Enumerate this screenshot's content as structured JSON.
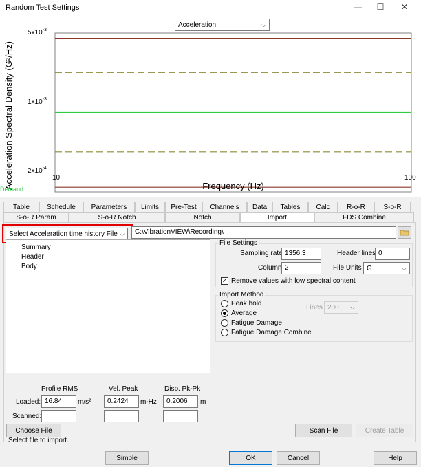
{
  "window": {
    "title": "Random Test Settings",
    "minimize": "—",
    "maximize": "☐",
    "close": "✕"
  },
  "chart_header": {
    "selected": "Acceleration"
  },
  "chart_data": {
    "type": "line",
    "ylabel": "Acceleration Spectral Density (G²/Hz)",
    "xlabel": "Frequency (Hz)",
    "x_scale": "log",
    "y_scale": "log",
    "xlim": [
      10,
      100
    ],
    "ylim": [
      0.0002,
      0.005
    ],
    "x_ticks": [
      "10",
      "100"
    ],
    "y_ticks": [
      {
        "base": "5x10",
        "exp": "-3"
      },
      {
        "base": "1x10",
        "exp": "-3"
      },
      {
        "base": "2x10",
        "exp": "-4"
      }
    ],
    "legend_label": "Demand",
    "series": [
      {
        "x": [
          10,
          100
        ],
        "y": [
          0.0045,
          0.0045
        ],
        "color": "#8b3a2a",
        "dash": false
      },
      {
        "x": [
          10,
          100
        ],
        "y": [
          0.00225,
          0.00225
        ],
        "color": "#8b8b3a",
        "dash": true
      },
      {
        "x": [
          10,
          100
        ],
        "y": [
          0.001,
          0.001
        ],
        "color": "#2ecc40",
        "dash": false
      },
      {
        "x": [
          10,
          100
        ],
        "y": [
          0.00045,
          0.00045
        ],
        "color": "#8b8b3a",
        "dash": true
      },
      {
        "x": [
          10,
          100
        ],
        "y": [
          0.00022,
          0.00022
        ],
        "color": "#8b3a2a",
        "dash": false
      }
    ]
  },
  "tabs_row1": [
    "Table",
    "Schedule",
    "Parameters",
    "Limits",
    "Pre-Test",
    "Channels",
    "Data",
    "Tables",
    "Calc",
    "R-o-R",
    "S-o-R"
  ],
  "tabs_row2": [
    "S-o-R Param",
    "S-o-R Notch",
    "Notch",
    "Import",
    "FDS Combine"
  ],
  "import": {
    "file_type": "Select Acceleration time history File",
    "path": "C:\\VibrationVIEW\\Recording\\",
    "tree": [
      "Summary",
      "Header",
      "Body"
    ]
  },
  "file_settings": {
    "title": "File Settings",
    "sampling_rate_label": "Sampling rate",
    "sampling_rate": "1356.3",
    "header_lines_label": "Header lines",
    "header_lines": "0",
    "column_label": "Column",
    "column": "2",
    "file_units_label": "File Units",
    "file_units": "G",
    "remove_label": "Remove values with low spectral content",
    "remove_checked": "✓"
  },
  "import_method": {
    "title": "Import Method",
    "options": [
      "Peak hold",
      "Average",
      "Fatigue Damage",
      "Fatigue Damage Combine"
    ],
    "lines_label": "Lines",
    "lines_value": "200"
  },
  "stats": {
    "col1": "Profile RMS",
    "col2": "Vel. Peak",
    "col3": "Disp. Pk-Pk",
    "loaded_label": "Loaded:",
    "scanned_label": "Scanned:",
    "rms": "16.84",
    "rms_unit": "m/s²",
    "vel": "0.2424",
    "vel_unit": "m-Hz",
    "disp": "0.2006",
    "disp_unit": "m"
  },
  "buttons": {
    "choose_file": "Choose File",
    "scan_file": "Scan File",
    "create_table": "Create Table",
    "simple": "Simple",
    "ok": "OK",
    "cancel": "Cancel",
    "help": "Help"
  },
  "status": "Select file to import."
}
